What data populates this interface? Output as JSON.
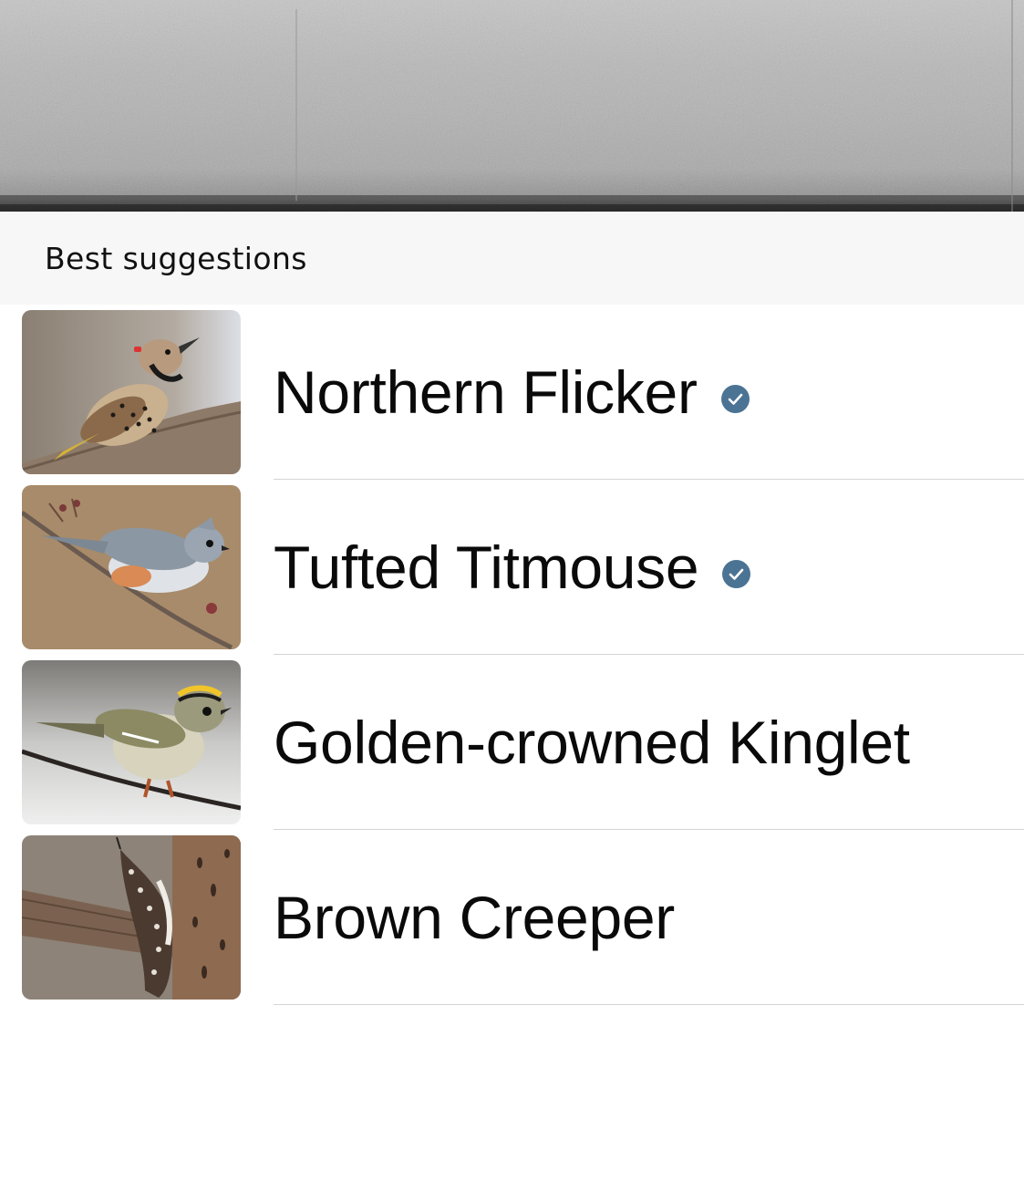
{
  "section": {
    "title": "Best suggestions"
  },
  "accent": {
    "verified_badge": "#4b7394"
  },
  "species": [
    {
      "name": "Northern Flicker",
      "verified": true,
      "photo_icon": "northern-flicker-photo"
    },
    {
      "name": "Tufted Titmouse",
      "verified": true,
      "photo_icon": "tufted-titmouse-photo"
    },
    {
      "name": "Golden-crowned Kinglet",
      "verified": false,
      "photo_icon": "golden-crowned-kinglet-photo"
    },
    {
      "name": "Brown Creeper",
      "verified": false,
      "photo_icon": "brown-creeper-photo"
    }
  ]
}
